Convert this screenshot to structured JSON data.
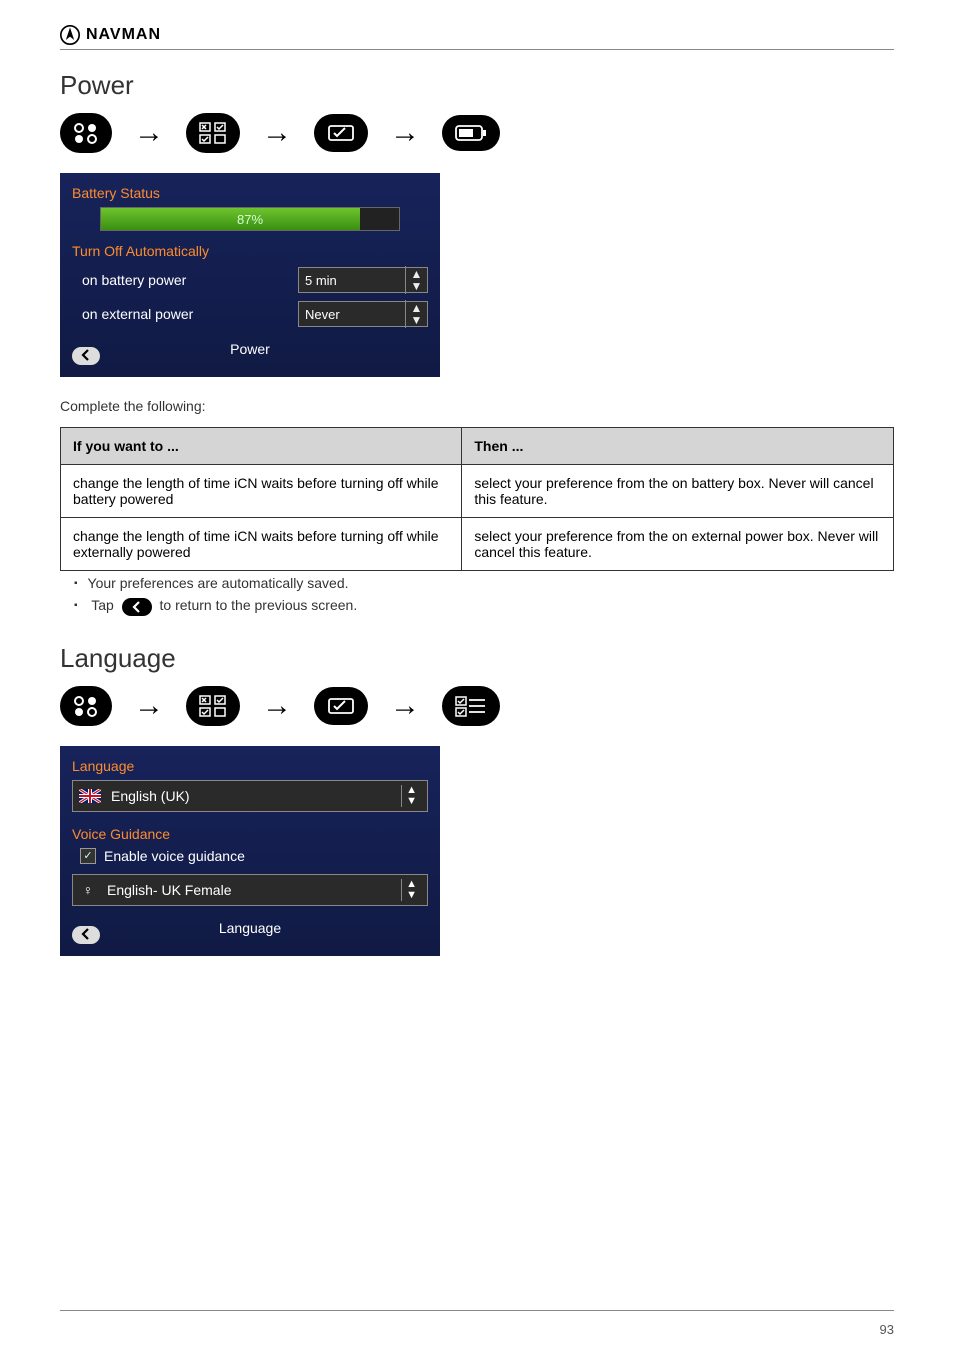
{
  "header": {
    "brand": "NAVMAN"
  },
  "sections": {
    "power": {
      "title": "Power",
      "crumbs": [
        "main-menu-icon",
        "preferences-icon",
        "settings-icon",
        "power-icon"
      ],
      "screenshot": {
        "battery_status_label": "Battery Status",
        "battery_percent": "87%",
        "battery_fill_pct": 87,
        "turn_off_label": "Turn Off Automatically",
        "row_battery_label": "on battery power",
        "row_battery_value": "5 min",
        "row_external_label": "on external power",
        "row_external_value": "Never",
        "footer_title": "Power"
      },
      "intro": "Complete the following:",
      "table": {
        "headers": [
          "If you want to ...",
          "Then ..."
        ],
        "rows": [
          [
            "change the length of time iCN waits before turning off while battery powered",
            "select your preference from the on battery box. Never will cancel this feature."
          ],
          [
            "change the length of time iCN waits before turning off while externally powered",
            "select your preference from the on external power box. Never will cancel this feature."
          ]
        ]
      },
      "bullets": {
        "item1": "Your preferences are automatically saved.",
        "item2_pre": "Tap",
        "item2_post": "to return to the previous screen."
      }
    },
    "language": {
      "title": "Language",
      "crumbs": [
        "main-menu-icon",
        "preferences-icon",
        "settings-icon",
        "language-icon"
      ],
      "screenshot": {
        "language_label": "Language",
        "language_value": "English (UK)",
        "voice_guidance_label": "Voice Guidance",
        "enable_voice_label": "Enable voice guidance",
        "voice_value": "English- UK Female",
        "footer_title": "Language"
      }
    }
  },
  "page_number": "93"
}
